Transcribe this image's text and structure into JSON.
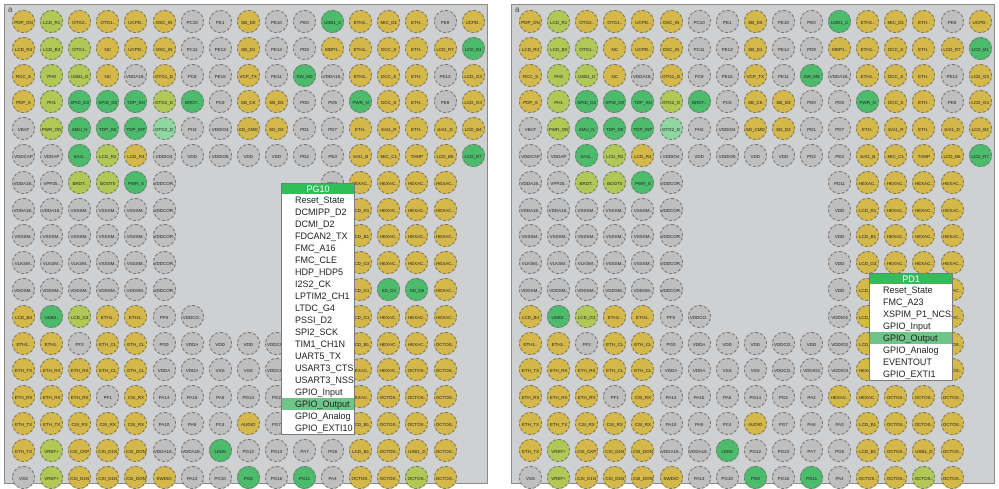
{
  "panels": [
    {
      "corner": "a",
      "menu": {
        "pin": "PG10",
        "selected": "GPIO_Output",
        "items": [
          "Reset_State",
          "DCMIPP_D2",
          "DCMI_D2",
          "FDCAN2_TX",
          "FMC_A16",
          "FMC_CLE",
          "HDP_HDP5",
          "I2S2_CK",
          "LPTIM2_CH1",
          "LTDC_G4",
          "PSSI_D2",
          "SPI2_SCK",
          "TIM1_CH1N",
          "UART5_TX",
          "USART3_CTS",
          "USART3_NSS",
          "GPIO_Input",
          "GPIO_Output",
          "GPIO_Analog",
          "GPIO_EXTI10"
        ]
      }
    },
    {
      "corner": "a",
      "menu": {
        "pin": "PD1",
        "selected": "GPIO_Output",
        "items": [
          "Reset_State",
          "FMC_A23",
          "XSPIM_P1_NCS2",
          "GPIO_Input",
          "GPIO_Output",
          "GPIO_Analog",
          "EVENTOUT",
          "GPIO_EXTI1"
        ]
      }
    }
  ],
  "grid": [
    [
      "PDP_ON",
      "LCD_R1",
      "OTG2..",
      "OTG1..",
      "UCPD..",
      "OSC_IN",
      "PC10",
      "PE1",
      "SB_D0",
      "PE10",
      "PE0",
      "USB1_C",
      "ETH1..",
      "MIC_D1",
      "ETH..",
      "PE9",
      "UCPD.."
    ],
    [
      "LCD_R4",
      "LCD_B3",
      "OTG1..",
      "NC",
      "UCPD..",
      "OSC_IN",
      "PC11",
      "PE13",
      "SB_D1",
      "PE14",
      "PD8",
      "MDP1..",
      "ETH1..",
      "DCC_S",
      "ETH..",
      "LCD_R7",
      "LCD_B1"
    ],
    [
      "RCC_S",
      "PH0",
      "USB1_D",
      "NC",
      "VDDA18..",
      "OTG1_D",
      "PC8",
      "PE15",
      "VCP_TX",
      "PE11",
      "SW_M0",
      "VDDA18..",
      "ETH1..",
      "DCC_S",
      "ETH..",
      "PE13",
      "LCD_G3"
    ],
    [
      "PDP_S",
      "PH1",
      "SPID_D3",
      "SPID_D0",
      "TDP_SN",
      "OTG2_D",
      "BRDT..",
      "PC9",
      "SB_CK",
      "SB_D3",
      "PD0",
      "PD5",
      "PWR_N",
      "DCC_S",
      "ETH..",
      "PE8",
      "LCD_G4"
    ],
    [
      "VBAT",
      "PWR_ON",
      "SMU_N",
      "TDP_SE",
      "TDP_INT",
      "OTG2_D",
      "PH2",
      "VDDIO4",
      "SD_CMD",
      "SD_D2",
      "PD1",
      "PD7",
      "ETH..",
      "SAI1_R",
      "ETH..",
      "SAI1_D",
      "LCD_B4"
    ],
    [
      "VDDCAP",
      "VDDAP",
      "SAI1..",
      "LCD_R2",
      "LCD_R4",
      "VDDIO4",
      "VDD",
      "VDDIO5",
      "VDD",
      "VDD",
      "PD2",
      "PE3",
      "SAI1_B",
      "MIC_C1",
      "TAMP",
      "LCD_B6",
      "LCD_R7"
    ],
    [
      "VDDA18..",
      "VPP25..",
      "BRDT..",
      "BOOT0",
      "PWR_S",
      "VDDCOR..",
      "",
      "",
      "",
      "",
      "",
      "PD11",
      "HEXAC..",
      "HEXAC..",
      "HEXAC..",
      "HEXAC..",
      ""
    ],
    [
      "VDDA18..",
      "VDDA18..",
      "VSSSM..",
      "VSSSM..",
      "VSSSM..",
      "VDDCOR..",
      "",
      "",
      "",
      "",
      "",
      "VDD",
      "LCD_R1",
      "HEXAC..",
      "HEXAC..",
      "HEXAC..",
      ""
    ],
    [
      "VSSSM..",
      "VSSSM..",
      "VSSSM..",
      "VSSSM..",
      "VSSSM..",
      "VDDCOR..",
      "",
      "",
      "",
      "",
      "",
      "VDD",
      "LCD_B1",
      "HEXAC..",
      "HEXAC..",
      "HEXAC..",
      ""
    ],
    [
      "VLKSM..",
      "VLKSM..",
      "VLKSM..",
      "VSSSM..",
      "VSSSM..",
      "VDDCOR..",
      "",
      "",
      "",
      "",
      "",
      "VDD",
      "LCD_G3",
      "HEXAC..",
      "HEXAC..",
      "HEXAC..",
      ""
    ],
    [
      "VDDSM..",
      "VDDSM..",
      "VDDSM..",
      "VDDSM..",
      "VDDSM..",
      "VDDCOR..",
      "",
      "",
      "",
      "",
      "",
      "VDD",
      "LCD_G1",
      "SD_D4",
      "SD_D5",
      "HEXAC..",
      ""
    ],
    [
      "LCD_B4",
      "USB2..",
      "LCD_G3",
      "ETH1..",
      "ETH1..",
      "PF6",
      "VDDCO..",
      "",
      "",
      "",
      "",
      "VDDIO2",
      "LCD_G1",
      "HEXAC..",
      "HEXAC..",
      "HEXAC..",
      ""
    ],
    [
      "ETH1..",
      "ETH1..",
      "PF2",
      "ETH_CL",
      "ETH_CL",
      "PG0",
      "VDDA",
      "VDD",
      "VDD",
      "VDDCO..",
      "VDD",
      "VDDIO2",
      "LCD_B1",
      "HEXAC..",
      "HEXAC..",
      "OCTOS..",
      ""
    ],
    [
      "ETH_TX",
      "ETH_RX",
      "ETH_RX",
      "ETH_CL",
      "ETH_CL",
      "VDDA",
      "VDDA",
      "VSS",
      "VSS",
      "VDDCO..",
      "VDDIO3",
      "VDDIO3",
      "HEXAC..",
      "HEXAC..",
      "OCTOS..",
      "OCTOS..",
      ""
    ],
    [
      "ETH_RX",
      "ETH_RX",
      "ETH_RX",
      "PF1",
      "CSI_RX",
      "PA14",
      "PA15",
      "PA5",
      "PG14",
      "PG2",
      "PA2",
      "HEXAC..",
      "HEXAC..",
      "OCTOS..",
      "OCTOS..",
      "OCTOS..",
      ""
    ],
    [
      "ETH_TX",
      "ETH_TX",
      "CSI_RX",
      "CSI_RX",
      "CSI_RX",
      "PA10",
      "PA9",
      "PC4",
      "AUDIO",
      "PG7",
      "PA6",
      "PA3",
      "LCD_B1",
      "OCTOS..",
      "OCTOS..",
      "OCTOS..",
      ""
    ],
    [
      "ETH_TX",
      "VREF+",
      "CSI_CKP",
      "CSI_D1N",
      "CSI_DON",
      "VDDA18..",
      "VDDA18..",
      "LED6",
      "PG12",
      "PG13",
      "PA7",
      "PG6",
      "LCD_B1",
      "OCTOS..",
      "USB1_D",
      "OCTOS..",
      ""
    ],
    [
      "VSS",
      "VREF+",
      "CSI_D1N",
      "CSI_D1N",
      "CSI_DON",
      "SWDIO",
      "PA13",
      "PG10",
      "PG8",
      "PG15",
      "PG11",
      "PA4",
      "OCTOS..",
      "OCTOS..",
      "OCTOS..",
      "OCTOS..",
      ""
    ]
  ],
  "colors": {
    "yellow": "#d4b84a",
    "gray": "#bfbfbf",
    "lightgreen": "#b3c757",
    "green": "#4dbb6c",
    "palegreen": "#8fd6a0",
    "menu_header": "#2fbf58",
    "menu_selected": "#6fc48a"
  }
}
